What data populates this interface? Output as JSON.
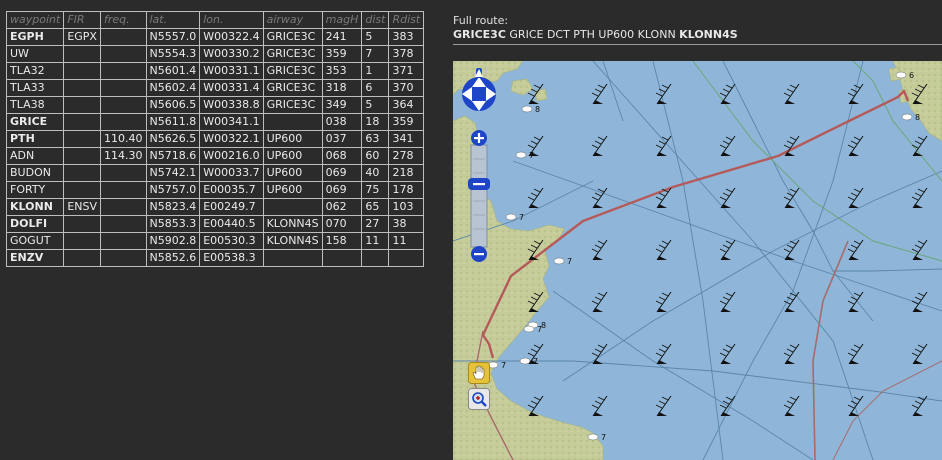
{
  "table": {
    "headers": [
      "waypoint",
      "FIR",
      "freq.",
      "lat.",
      "lon.",
      "airway",
      "magH",
      "dist",
      "Rdist"
    ],
    "rows": [
      {
        "waypoint": "EGPH",
        "fir": "EGPX",
        "freq": "",
        "lat": "N5557.0",
        "lon": "W00322.4",
        "airway": "GRICE3C",
        "magH": "241",
        "dist": "5",
        "rdist": "383",
        "bold": true
      },
      {
        "waypoint": "UW",
        "fir": "",
        "freq": "",
        "lat": "N5554.3",
        "lon": "W00330.2",
        "airway": "GRICE3C",
        "magH": "359",
        "dist": "7",
        "rdist": "378",
        "bold": false
      },
      {
        "waypoint": "TLA32",
        "fir": "",
        "freq": "",
        "lat": "N5601.4",
        "lon": "W00331.1",
        "airway": "GRICE3C",
        "magH": "353",
        "dist": "1",
        "rdist": "371",
        "bold": false
      },
      {
        "waypoint": "TLA33",
        "fir": "",
        "freq": "",
        "lat": "N5602.4",
        "lon": "W00331.4",
        "airway": "GRICE3C",
        "magH": "318",
        "dist": "6",
        "rdist": "370",
        "bold": false
      },
      {
        "waypoint": "TLA38",
        "fir": "",
        "freq": "",
        "lat": "N5606.5",
        "lon": "W00338.8",
        "airway": "GRICE3C",
        "magH": "349",
        "dist": "5",
        "rdist": "364",
        "bold": false
      },
      {
        "waypoint": "GRICE",
        "fir": "",
        "freq": "",
        "lat": "N5611.8",
        "lon": "W00341.1",
        "airway": "",
        "magH": "038",
        "dist": "18",
        "rdist": "359",
        "bold": true
      },
      {
        "waypoint": "PTH",
        "fir": "",
        "freq": "110.40",
        "lat": "N5626.5",
        "lon": "W00322.1",
        "airway": "UP600",
        "magH": "037",
        "dist": "63",
        "rdist": "341",
        "bold": true
      },
      {
        "waypoint": "ADN",
        "fir": "",
        "freq": "114.30",
        "lat": "N5718.6",
        "lon": "W00216.0",
        "airway": "UP600",
        "magH": "068",
        "dist": "60",
        "rdist": "278",
        "bold": false
      },
      {
        "waypoint": "BUDON",
        "fir": "",
        "freq": "",
        "lat": "N5742.1",
        "lon": "W00033.7",
        "airway": "UP600",
        "magH": "069",
        "dist": "40",
        "rdist": "218",
        "bold": false
      },
      {
        "waypoint": "FORTY",
        "fir": "",
        "freq": "",
        "lat": "N5757.0",
        "lon": "E00035.7",
        "airway": "UP600",
        "magH": "069",
        "dist": "75",
        "rdist": "178",
        "bold": false
      },
      {
        "waypoint": "KLONN",
        "fir": "ENSV",
        "freq": "",
        "lat": "N5823.4",
        "lon": "E00249.7",
        "airway": "",
        "magH": "062",
        "dist": "65",
        "rdist": "103",
        "bold": true
      },
      {
        "waypoint": "DOLFI",
        "fir": "",
        "freq": "",
        "lat": "N5853.3",
        "lon": "E00440.5",
        "airway": "KLONN4S",
        "magH": "070",
        "dist": "27",
        "rdist": "38",
        "bold": true
      },
      {
        "waypoint": "GOGUT",
        "fir": "",
        "freq": "",
        "lat": "N5902.8",
        "lon": "E00530.3",
        "airway": "KLONN4S",
        "magH": "158",
        "dist": "11",
        "rdist": "11",
        "bold": false
      },
      {
        "waypoint": "ENZV",
        "fir": "",
        "freq": "",
        "lat": "N5852.6",
        "lon": "E00538.3",
        "airway": "",
        "magH": "",
        "dist": "",
        "rdist": "",
        "bold": true
      }
    ]
  },
  "full_route": {
    "label": "Full route:",
    "sid": "GRICE3C",
    "middle": " GRICE DCT PTH UP600 KLONN ",
    "star": "KLONN4S"
  },
  "map": {
    "icons": [
      "pan-arrows-icon",
      "zoom-in-icon",
      "zoom-out-icon",
      "hand-icon",
      "zoom-box-icon",
      "wind-barb-icon",
      "cloud-icon"
    ],
    "cloud_labels": [
      "6",
      "8",
      "7",
      "7",
      "7",
      "8",
      "7",
      "7",
      "7",
      "7",
      "7",
      "8"
    ],
    "colors": {
      "sea": "#8fb6d8",
      "land": "#c9cf9f",
      "route": "#b55a5a",
      "fir": "#4a7aa0",
      "nav": "#1e44c8"
    }
  }
}
